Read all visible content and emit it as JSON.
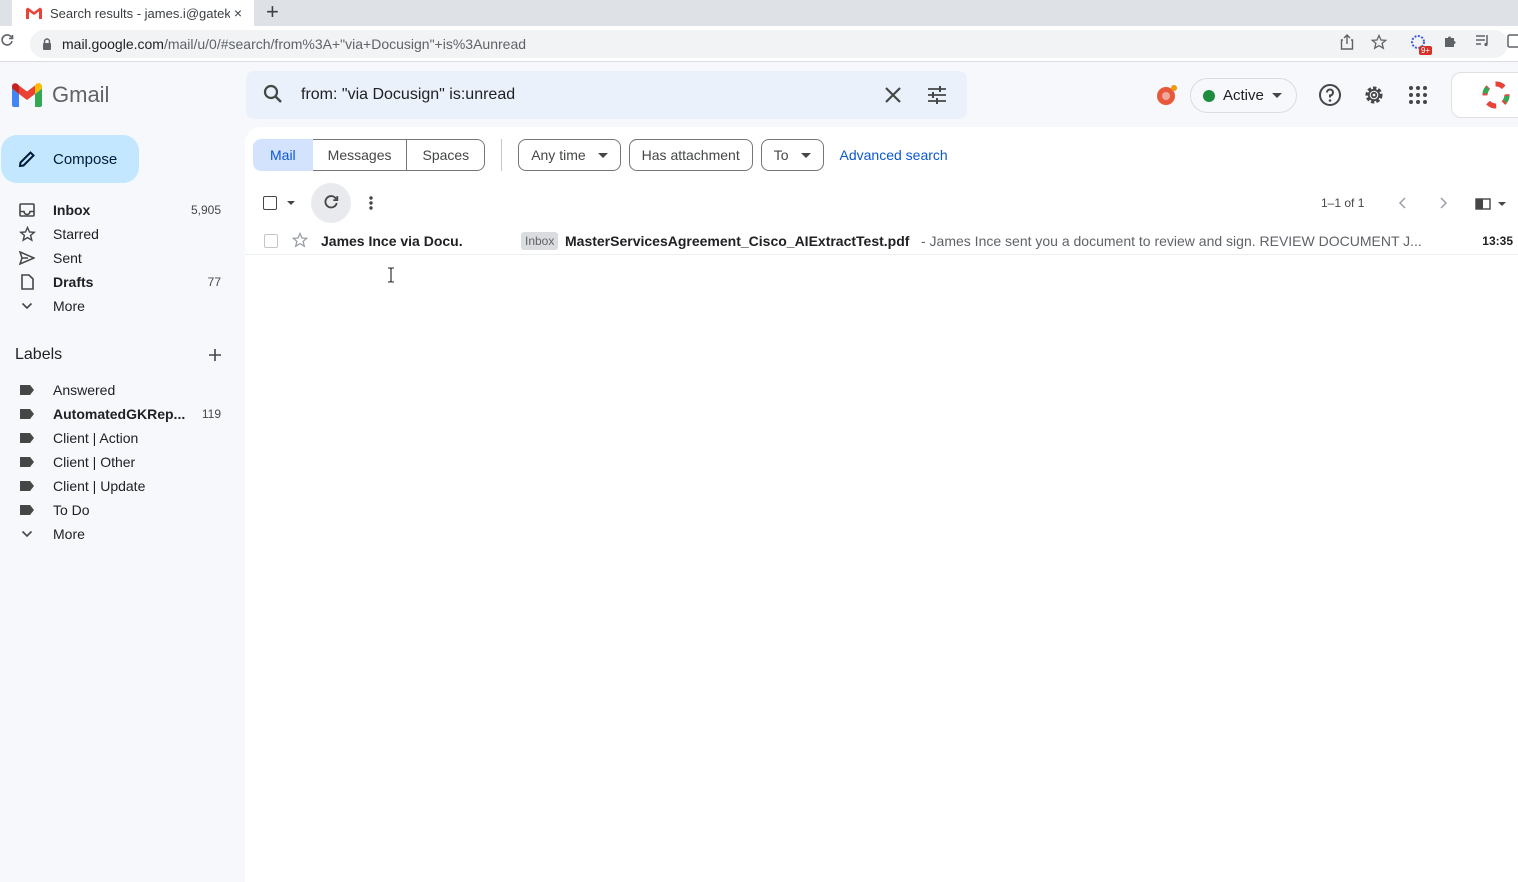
{
  "browser": {
    "tab_title": "Search results - james.i@gatek",
    "tab_close": "×",
    "new_tab": "+",
    "url_host": "mail.google.com",
    "url_path": "/mail/u/0/#search/from%3A+\"via+Docusign\"+is%3Aunread",
    "extension_badge": "9+"
  },
  "header": {
    "logo_text": "Gmail",
    "search_value": "from: \"via Docusign\" is:unread",
    "status_label": "Active"
  },
  "compose_label": "Compose",
  "nav": [
    {
      "label": "Inbox",
      "count": "5,905",
      "icon": "inbox-icon",
      "bold": true
    },
    {
      "label": "Starred",
      "count": "",
      "icon": "star-icon",
      "bold": false
    },
    {
      "label": "Sent",
      "count": "",
      "icon": "send-icon",
      "bold": false
    },
    {
      "label": "Drafts",
      "count": "77",
      "icon": "draft-icon",
      "bold": true
    },
    {
      "label": "More",
      "count": "",
      "icon": "chevron-down-icon",
      "bold": false
    }
  ],
  "labels_title": "Labels",
  "labels": [
    {
      "label": "Answered",
      "count": "",
      "bold": false
    },
    {
      "label": "AutomatedGKRep...",
      "count": "119",
      "bold": true
    },
    {
      "label": "Client | Action",
      "count": "",
      "bold": false
    },
    {
      "label": "Client | Other",
      "count": "",
      "bold": false
    },
    {
      "label": "Client | Update",
      "count": "",
      "bold": false
    },
    {
      "label": "To Do",
      "count": "",
      "bold": false
    },
    {
      "label": "More",
      "count": "",
      "bold": false
    }
  ],
  "filters": {
    "mail": "Mail",
    "messages": "Messages",
    "spaces": "Spaces",
    "any_time": "Any time",
    "has_attachment": "Has attachment",
    "to": "To",
    "advanced": "Advanced search"
  },
  "pager": "1–1 of 1",
  "email": {
    "sender": "James Ince via Docu.",
    "badge": "Inbox",
    "subject": "MasterServicesAgreement_Cisco_AIExtractTest.pdf",
    "snippet": " - James Ince sent you a document to review and sign. REVIEW DOCUMENT J...",
    "time": "13:35"
  },
  "colors": {
    "accent": "#0b57d0",
    "compose_bg": "#c2e7ff",
    "status_green": "#1e8e3e",
    "page_bg": "#f6f8fc"
  }
}
